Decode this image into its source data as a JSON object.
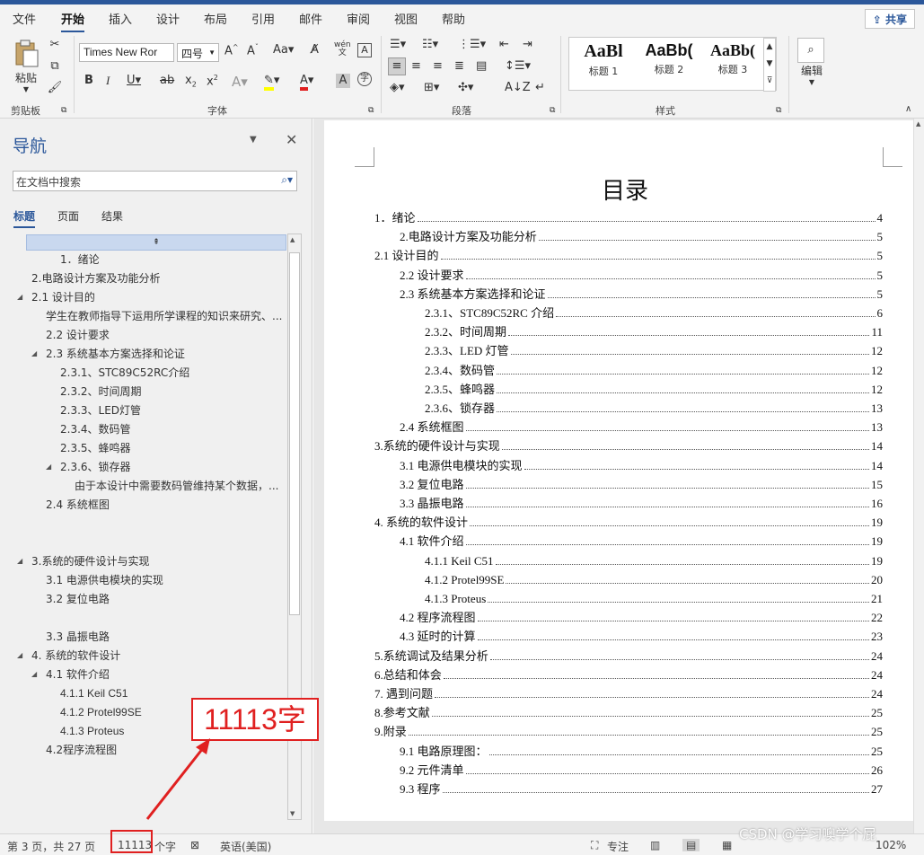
{
  "tabs": [
    "文件",
    "开始",
    "插入",
    "设计",
    "布局",
    "引用",
    "邮件",
    "审阅",
    "视图",
    "帮助"
  ],
  "active_tab": "开始",
  "share_label": "共享",
  "ribbon": {
    "clipboard": {
      "paste_label": "粘贴",
      "group_label": "剪贴板"
    },
    "font": {
      "font_name": "Times New Ror",
      "font_size": "四号",
      "group_label": "字体"
    },
    "paragraph": {
      "group_label": "段落"
    },
    "styles": {
      "items": [
        {
          "preview": "AaBl",
          "label": "标题 1"
        },
        {
          "preview": "AaBb(",
          "label": "标题 2"
        },
        {
          "preview": "AaBb(",
          "label": "标题 3"
        }
      ],
      "group_label": "样式"
    },
    "editing": {
      "label": "编辑"
    }
  },
  "nav": {
    "title": "导航",
    "search_placeholder": "在文档中搜索",
    "tabs": [
      "标题",
      "页面",
      "结果"
    ],
    "items": [
      "1．绪论",
      "2.电路设计方案及功能分析",
      "2.1 设计目的",
      "学生在教师指导下运用所学课程的知识来研究、...",
      "2.2 设计要求",
      "2.3 系统基本方案选择和论证",
      "2.3.1、STC89C52RC介绍",
      "2.3.2、时间周期",
      "2.3.3、LED灯管",
      "2.3.4、数码管",
      "2.3.5、蜂鸣器",
      "2.3.6、锁存器",
      "由于本设计中需要数码管维持某个数据，...",
      "2.4 系统框图",
      "3.系统的硬件设计与实现",
      "3.1 电源供电模块的实现",
      "3.2 复位电路",
      "3.3 晶振电路",
      "4.  系统的软件设计",
      "4.1 软件介绍",
      "4.1.1 Keil C51",
      "4.1.2 Protel99SE",
      "4.1.3 Proteus",
      "4.2程序流程图"
    ]
  },
  "doc": {
    "title": "目录",
    "toc": [
      {
        "text": "1．绪论",
        "page": "4"
      },
      {
        "text": "2.电路设计方案及功能分析",
        "page": "5"
      },
      {
        "text": "2.1  设计目的",
        "page": "5"
      },
      {
        "text": "2.2  设计要求",
        "page": "5"
      },
      {
        "text": "2.3  系统基本方案选择和论证",
        "page": "5"
      },
      {
        "text": "2.3.1、STC89C52RC 介绍",
        "page": "6"
      },
      {
        "text": "2.3.2、时间周期",
        "page": "11"
      },
      {
        "text": "2.3.3、LED 灯管",
        "page": "12"
      },
      {
        "text": "2.3.4、数码管",
        "page": "12"
      },
      {
        "text": "2.3.5、蜂鸣器",
        "page": "12"
      },
      {
        "text": "2.3.6、锁存器",
        "page": "13"
      },
      {
        "text": "2.4  系统框图",
        "page": "13"
      },
      {
        "text": "3.系统的硬件设计与实现",
        "page": "14"
      },
      {
        "text": "3.1  电源供电模块的实现",
        "page": "14"
      },
      {
        "text": "3.2  复位电路",
        "page": "15"
      },
      {
        "text": "3.3  晶振电路",
        "page": "16"
      },
      {
        "text": "4.    系统的软件设计",
        "page": "19"
      },
      {
        "text": "4.1  软件介绍",
        "page": "19"
      },
      {
        "text": "4.1.1 Keil C51",
        "page": "19"
      },
      {
        "text": "4.1.2 Protel99SE",
        "page": "20"
      },
      {
        "text": "4.1.3 Proteus",
        "page": "21"
      },
      {
        "text": "4.2 程序流程图",
        "page": "22"
      },
      {
        "text": "4.3  延时的计算",
        "page": "23"
      },
      {
        "text": "5.系统调试及结果分析",
        "page": "24"
      },
      {
        "text": "6.总结和体会",
        "page": "24"
      },
      {
        "text": "7. 遇到问题",
        "page": "24"
      },
      {
        "text": "8.参考文献",
        "page": "25"
      },
      {
        "text": "9.附录",
        "page": "25"
      },
      {
        "text": "9.1 电路原理图：",
        "page": "25"
      },
      {
        "text": "9.2  元件清单",
        "page": "26"
      },
      {
        "text": "9.3 程序",
        "page": "27"
      }
    ]
  },
  "status": {
    "page_info": "第 3 页，共 27 页",
    "word_count": "11113",
    "word_suffix": "个字",
    "language": "英语(美国)",
    "focus": "专注",
    "zoom": "102%"
  },
  "callout": "11113字",
  "watermark": "CSDN @学习噢学个屁",
  "colors": {
    "accent": "#2b579a",
    "annotation": "#e02020"
  }
}
